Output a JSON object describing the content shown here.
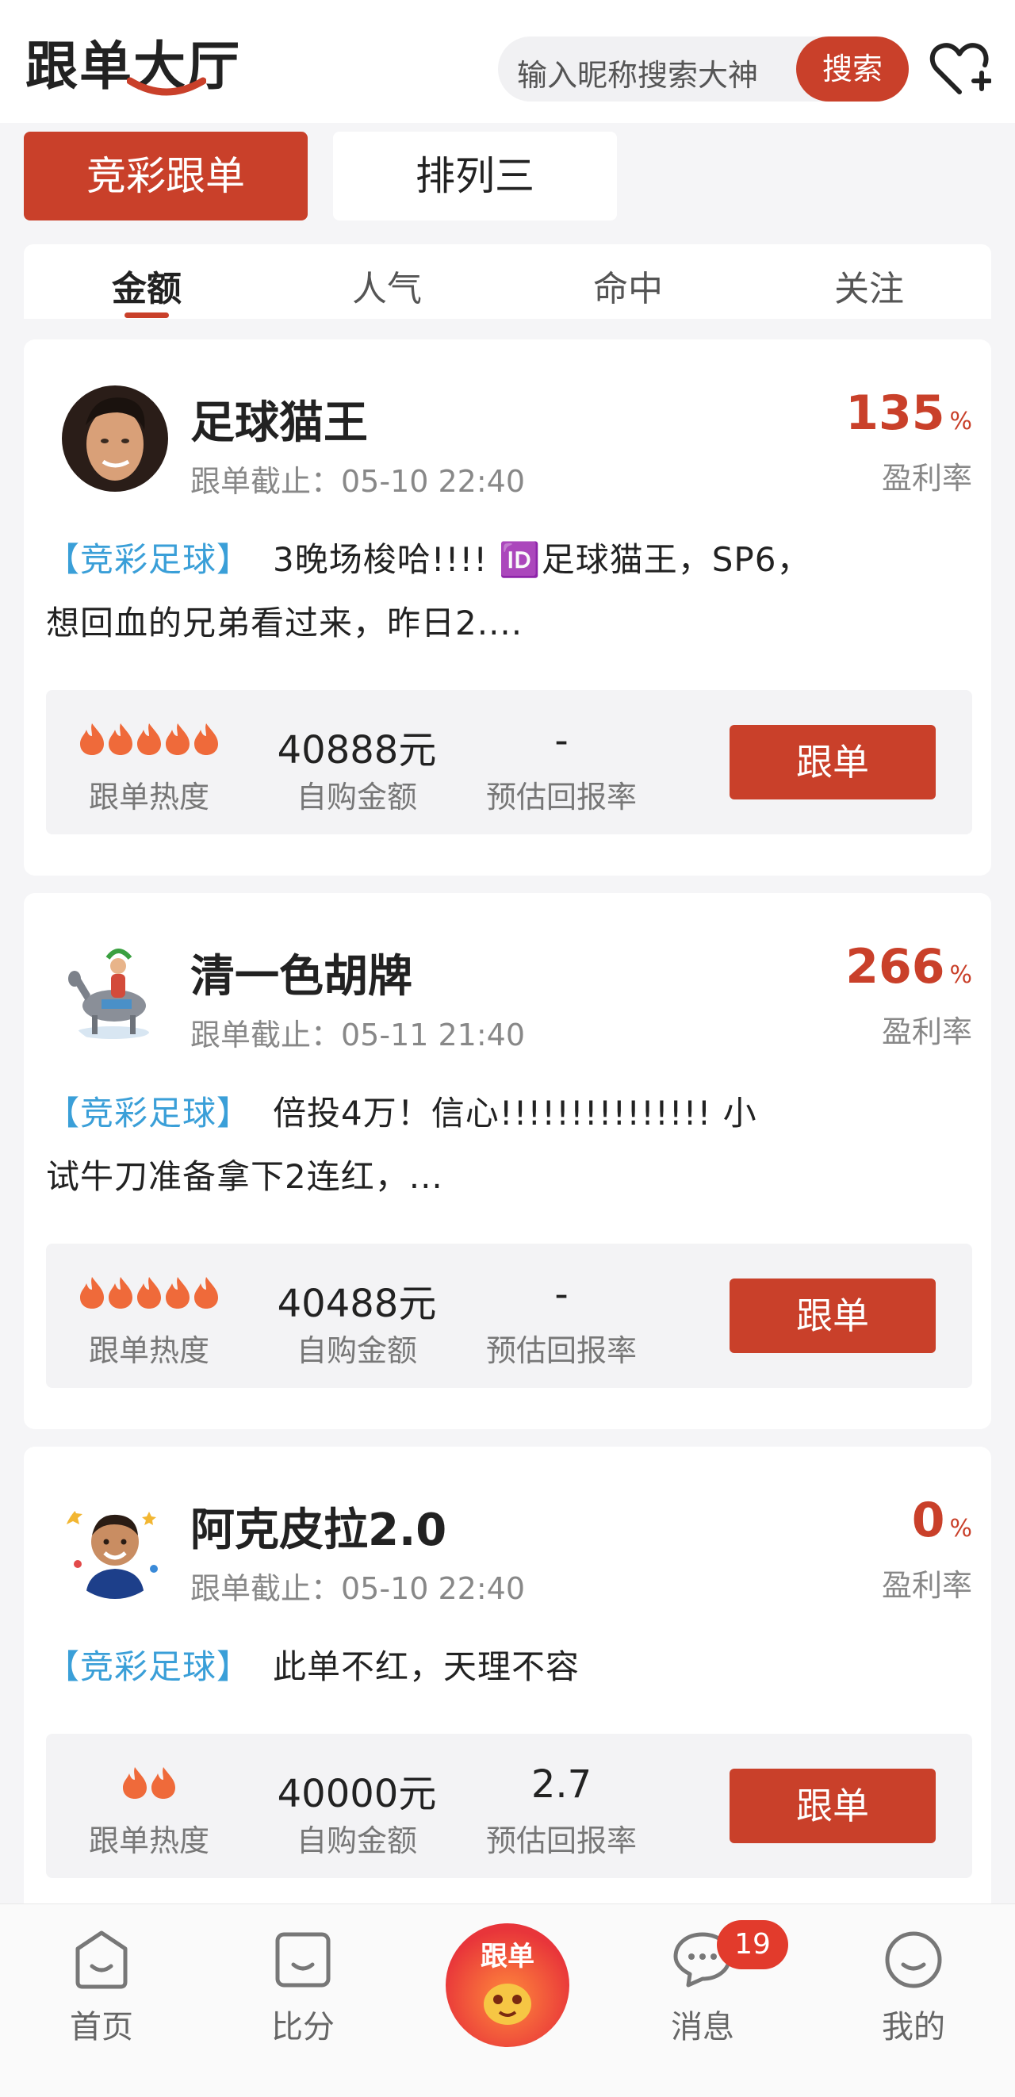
{
  "header": {
    "title": "跟单大厅",
    "search_placeholder": "输入昵称搜索大神",
    "search_button": "搜索"
  },
  "lottery_tabs": [
    {
      "label": "竞彩跟单",
      "active": true
    },
    {
      "label": "排列三",
      "active": false
    }
  ],
  "sort_tabs": [
    {
      "label": "金额",
      "active": true
    },
    {
      "label": "人气",
      "active": false
    },
    {
      "label": "命中",
      "active": false
    },
    {
      "label": "关注",
      "active": false
    }
  ],
  "cards": [
    {
      "name": "足球猫王",
      "deadline": "跟单截止：05-10 22:40",
      "rate": "135",
      "rate_unit": "%",
      "rate_label": "盈利率",
      "tag": "【竞彩足球】",
      "desc_line1": "3晚场梭哈!!!! 🆔足球猫王，SP6，",
      "desc_line2": "想回血的兄弟看过来，昨日2....",
      "heat": 5,
      "heat_label": "跟单热度",
      "amount": "40888元",
      "amount_label": "自购金额",
      "return": "-",
      "return_label": "预估回报率",
      "button": "跟单"
    },
    {
      "name": "清一色胡牌",
      "deadline": "跟单截止：05-11 21:40",
      "rate": "266",
      "rate_unit": "%",
      "rate_label": "盈利率",
      "tag": "【竞彩足球】",
      "desc_line1": "倍投4万！信心!!!!!!!!!!!!!!! 小",
      "desc_line2": "试牛刀准备拿下2连红，...",
      "heat": 5,
      "heat_label": "跟单热度",
      "amount": "40488元",
      "amount_label": "自购金额",
      "return": "-",
      "return_label": "预估回报率",
      "button": "跟单"
    },
    {
      "name": "阿克皮拉2.0",
      "deadline": "跟单截止：05-10 22:40",
      "rate": "0",
      "rate_unit": "%",
      "rate_label": "盈利率",
      "tag": "【竞彩足球】",
      "desc_line1": "此单不红，天理不容",
      "desc_line2": "",
      "heat": 2,
      "heat_label": "跟单热度",
      "amount": "40000元",
      "amount_label": "自购金额",
      "return": "2.7",
      "return_label": "预估回报率",
      "button": "跟单"
    }
  ],
  "bottom_nav": {
    "home": "首页",
    "score": "比分",
    "center": "跟单",
    "messages": "消息",
    "messages_badge": "19",
    "mine": "我的"
  },
  "colors": {
    "accent": "#c9402a",
    "tag_blue": "#3a9fd8",
    "background": "#f5f5f7"
  }
}
